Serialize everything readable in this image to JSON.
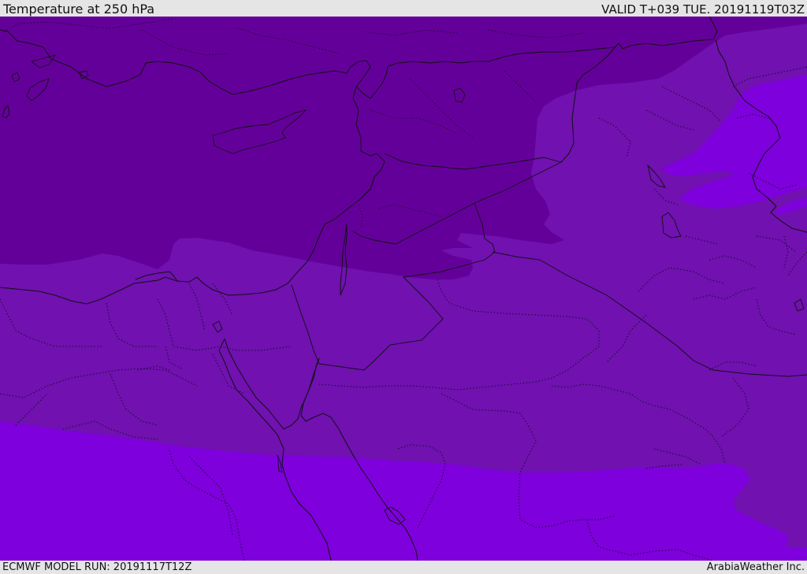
{
  "header": {
    "title": "Temperature at 250 hPa",
    "valid_time": "VALID T+039 TUE. 20191119T03Z"
  },
  "footer": {
    "model_run": "ECMWF MODEL RUN: 20191117T12Z",
    "credit": "ArabiaWeather Inc."
  },
  "colors": {
    "coldest_band": "#64009a",
    "mid_band": "#7011b0",
    "warm_band": "#7e00dc",
    "lines": "#111111",
    "frame": "#e5e5e5"
  }
}
